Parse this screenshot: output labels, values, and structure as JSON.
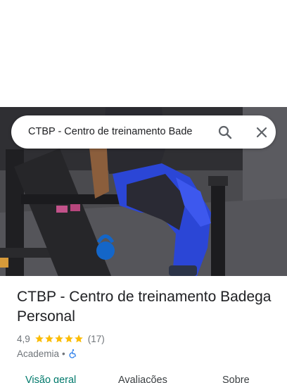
{
  "search": {
    "query": "CTBP - Centro de treinamento Bade"
  },
  "place": {
    "name": "CTBP - Centro de treinamento Badega Personal",
    "rating": "4,9",
    "stars": 5,
    "review_count": "(17)",
    "category": "Academia",
    "separator": "•"
  },
  "tabs": [
    {
      "label": "Visão geral",
      "active": true
    },
    {
      "label": "Avaliações",
      "active": false
    },
    {
      "label": "Sobre",
      "active": false
    }
  ],
  "icons": {
    "search": "search-icon",
    "close": "close-icon",
    "star": "star-icon",
    "accessibility": "wheelchair-icon"
  },
  "colors": {
    "text_primary": "#202124",
    "text_secondary": "#70757a",
    "star": "#fbbc04",
    "active_tab": "#00796b",
    "accessibility_icon": "#1a73e8"
  }
}
